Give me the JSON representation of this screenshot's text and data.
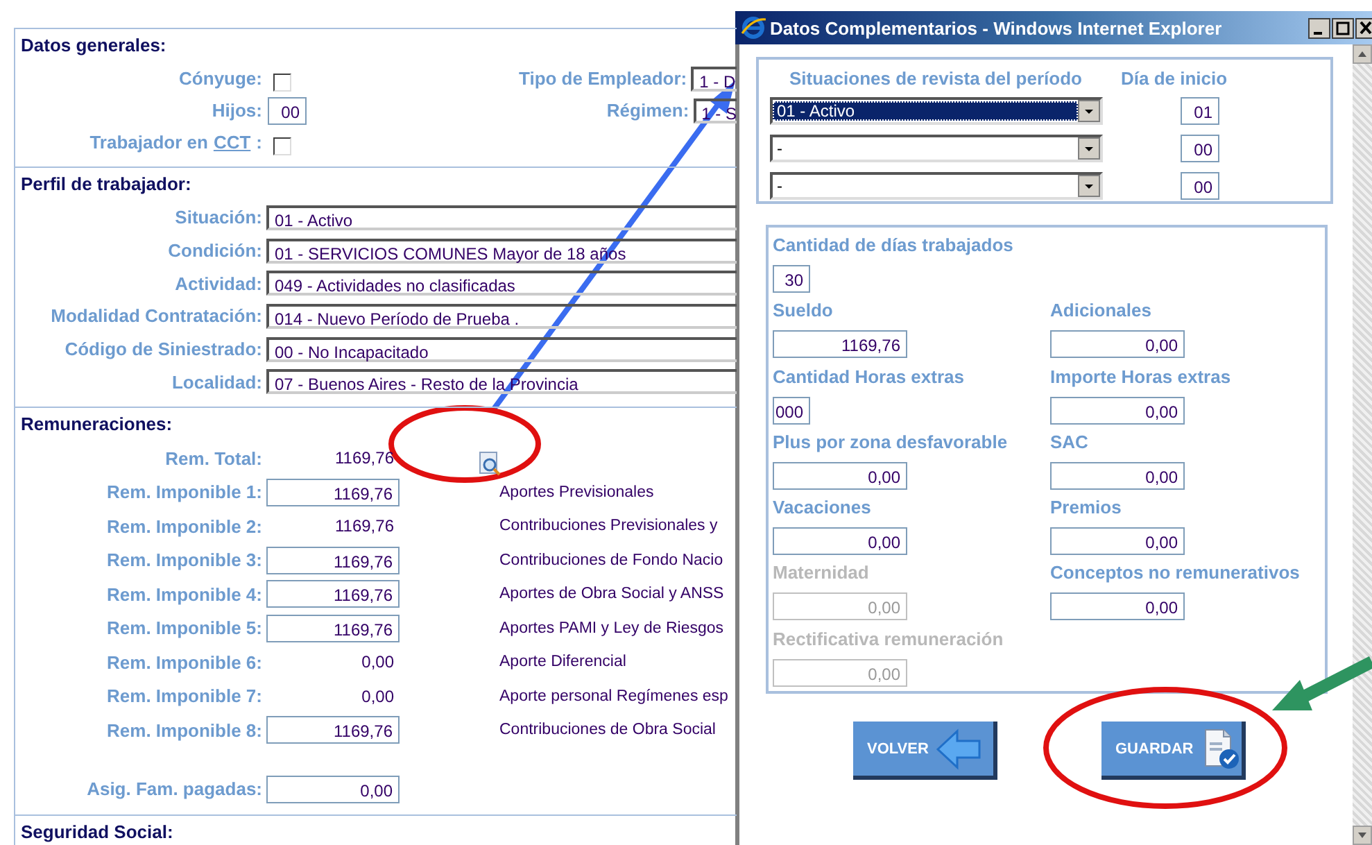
{
  "general": {
    "title": "Datos generales:",
    "conyuge": {
      "label": "Cónyuge:",
      "checked": false
    },
    "hijos": {
      "label": "Hijos:",
      "value": "00"
    },
    "cct": {
      "label": "Trabajador en",
      "link": "CCT",
      "suffix": ":",
      "checked": false
    },
    "tipo_empleador": {
      "label": "Tipo de Empleador:",
      "value": "1 - D"
    },
    "regimen": {
      "label": "Régimen:",
      "value": "1 - S"
    }
  },
  "perfil": {
    "title": "Perfil de trabajador:",
    "fields": [
      {
        "label": "Situación:",
        "value": "01 - Activo"
      },
      {
        "label": "Condición:",
        "value": "01 - SERVICIOS COMUNES Mayor de 18 años"
      },
      {
        "label": "Actividad:",
        "value": "049 - Actividades no clasificadas"
      },
      {
        "label": "Modalidad Contratación:",
        "value": "014 - Nuevo Período de Prueba ."
      },
      {
        "label": "Código de Siniestrado:",
        "value": "00 - No Incapacitado"
      },
      {
        "label": "Localidad:",
        "value": "07 - Buenos Aires - Resto de la Provincia"
      }
    ]
  },
  "remuneraciones": {
    "title": "Remuneraciones:",
    "total": {
      "label": "Rem. Total:",
      "value": "1169,76"
    },
    "rows": [
      {
        "label": "Rem. Imponible 1:",
        "value": "1169,76",
        "kind": "input",
        "concept": "Aportes Previsionales"
      },
      {
        "label": "Rem. Imponible 2:",
        "value": "1169,76",
        "kind": "text",
        "concept": "Contribuciones Previsionales y"
      },
      {
        "label": "Rem. Imponible 3:",
        "value": "1169,76",
        "kind": "input",
        "concept": "Contribuciones de Fondo Nacio"
      },
      {
        "label": "Rem. Imponible 4:",
        "value": "1169,76",
        "kind": "input",
        "concept": "Aportes de Obra Social y ANSS"
      },
      {
        "label": "Rem. Imponible 5:",
        "value": "1169,76",
        "kind": "input",
        "concept": "Aportes PAMI y Ley de Riesgos"
      },
      {
        "label": "Rem. Imponible 6:",
        "value": "0,00",
        "kind": "text",
        "concept": "Aporte Diferencial"
      },
      {
        "label": "Rem. Imponible 7:",
        "value": "0,00",
        "kind": "text",
        "concept": "Aporte personal Regímenes esp"
      },
      {
        "label": "Rem. Imponible 8:",
        "value": "1169,76",
        "kind": "input",
        "concept": "Contribuciones de Obra Social"
      }
    ],
    "asig": {
      "label": "Asig. Fam. pagadas:",
      "value": "0,00"
    }
  },
  "seguridad_social": {
    "title": "Seguridad Social:"
  },
  "popup": {
    "title": "Datos Complementarios - Windows Internet Explorer",
    "situaciones_header": "Situaciones de revista del período",
    "dia_header": "Día de inicio",
    "situaciones": [
      {
        "value": "01 - Activo",
        "selected": true,
        "day": "01"
      },
      {
        "value": "-",
        "selected": false,
        "day": "00"
      },
      {
        "value": "-",
        "selected": false,
        "day": "00"
      }
    ],
    "rows": [
      [
        {
          "label": "Cantidad de días trabajados",
          "value": "30",
          "kind": "short",
          "disabled": false
        }
      ],
      [
        {
          "label": "Sueldo",
          "value": "1169,76",
          "kind": "amount",
          "disabled": false
        },
        {
          "label": "Adicionales",
          "value": "0,00",
          "kind": "amount",
          "disabled": false
        }
      ],
      [
        {
          "label": "Cantidad Horas extras",
          "value": "000",
          "kind": "short",
          "disabled": false
        },
        {
          "label": "Importe Horas extras",
          "value": "0,00",
          "kind": "amount",
          "disabled": false
        }
      ],
      [
        {
          "label": "Plus por zona desfavorable",
          "value": "0,00",
          "kind": "amount",
          "disabled": false
        },
        {
          "label": "SAC",
          "value": "0,00",
          "kind": "amount",
          "disabled": false
        }
      ],
      [
        {
          "label": "Vacaciones",
          "value": "0,00",
          "kind": "amount",
          "disabled": false
        },
        {
          "label": "Premios",
          "value": "0,00",
          "kind": "amount",
          "disabled": false
        }
      ],
      [
        {
          "label": "Maternidad",
          "value": "0,00",
          "kind": "amount",
          "disabled": true
        },
        {
          "label": "Conceptos no remunerativos",
          "value": "0,00",
          "kind": "amount",
          "disabled": false
        }
      ],
      [
        {
          "label": "Rectificativa  remuneración",
          "value": "0,00",
          "kind": "amount",
          "disabled": true
        }
      ]
    ],
    "buttons": [
      {
        "label": "VOLVER",
        "kind": "back"
      },
      {
        "label": "GUARDAR",
        "kind": "save"
      }
    ]
  }
}
